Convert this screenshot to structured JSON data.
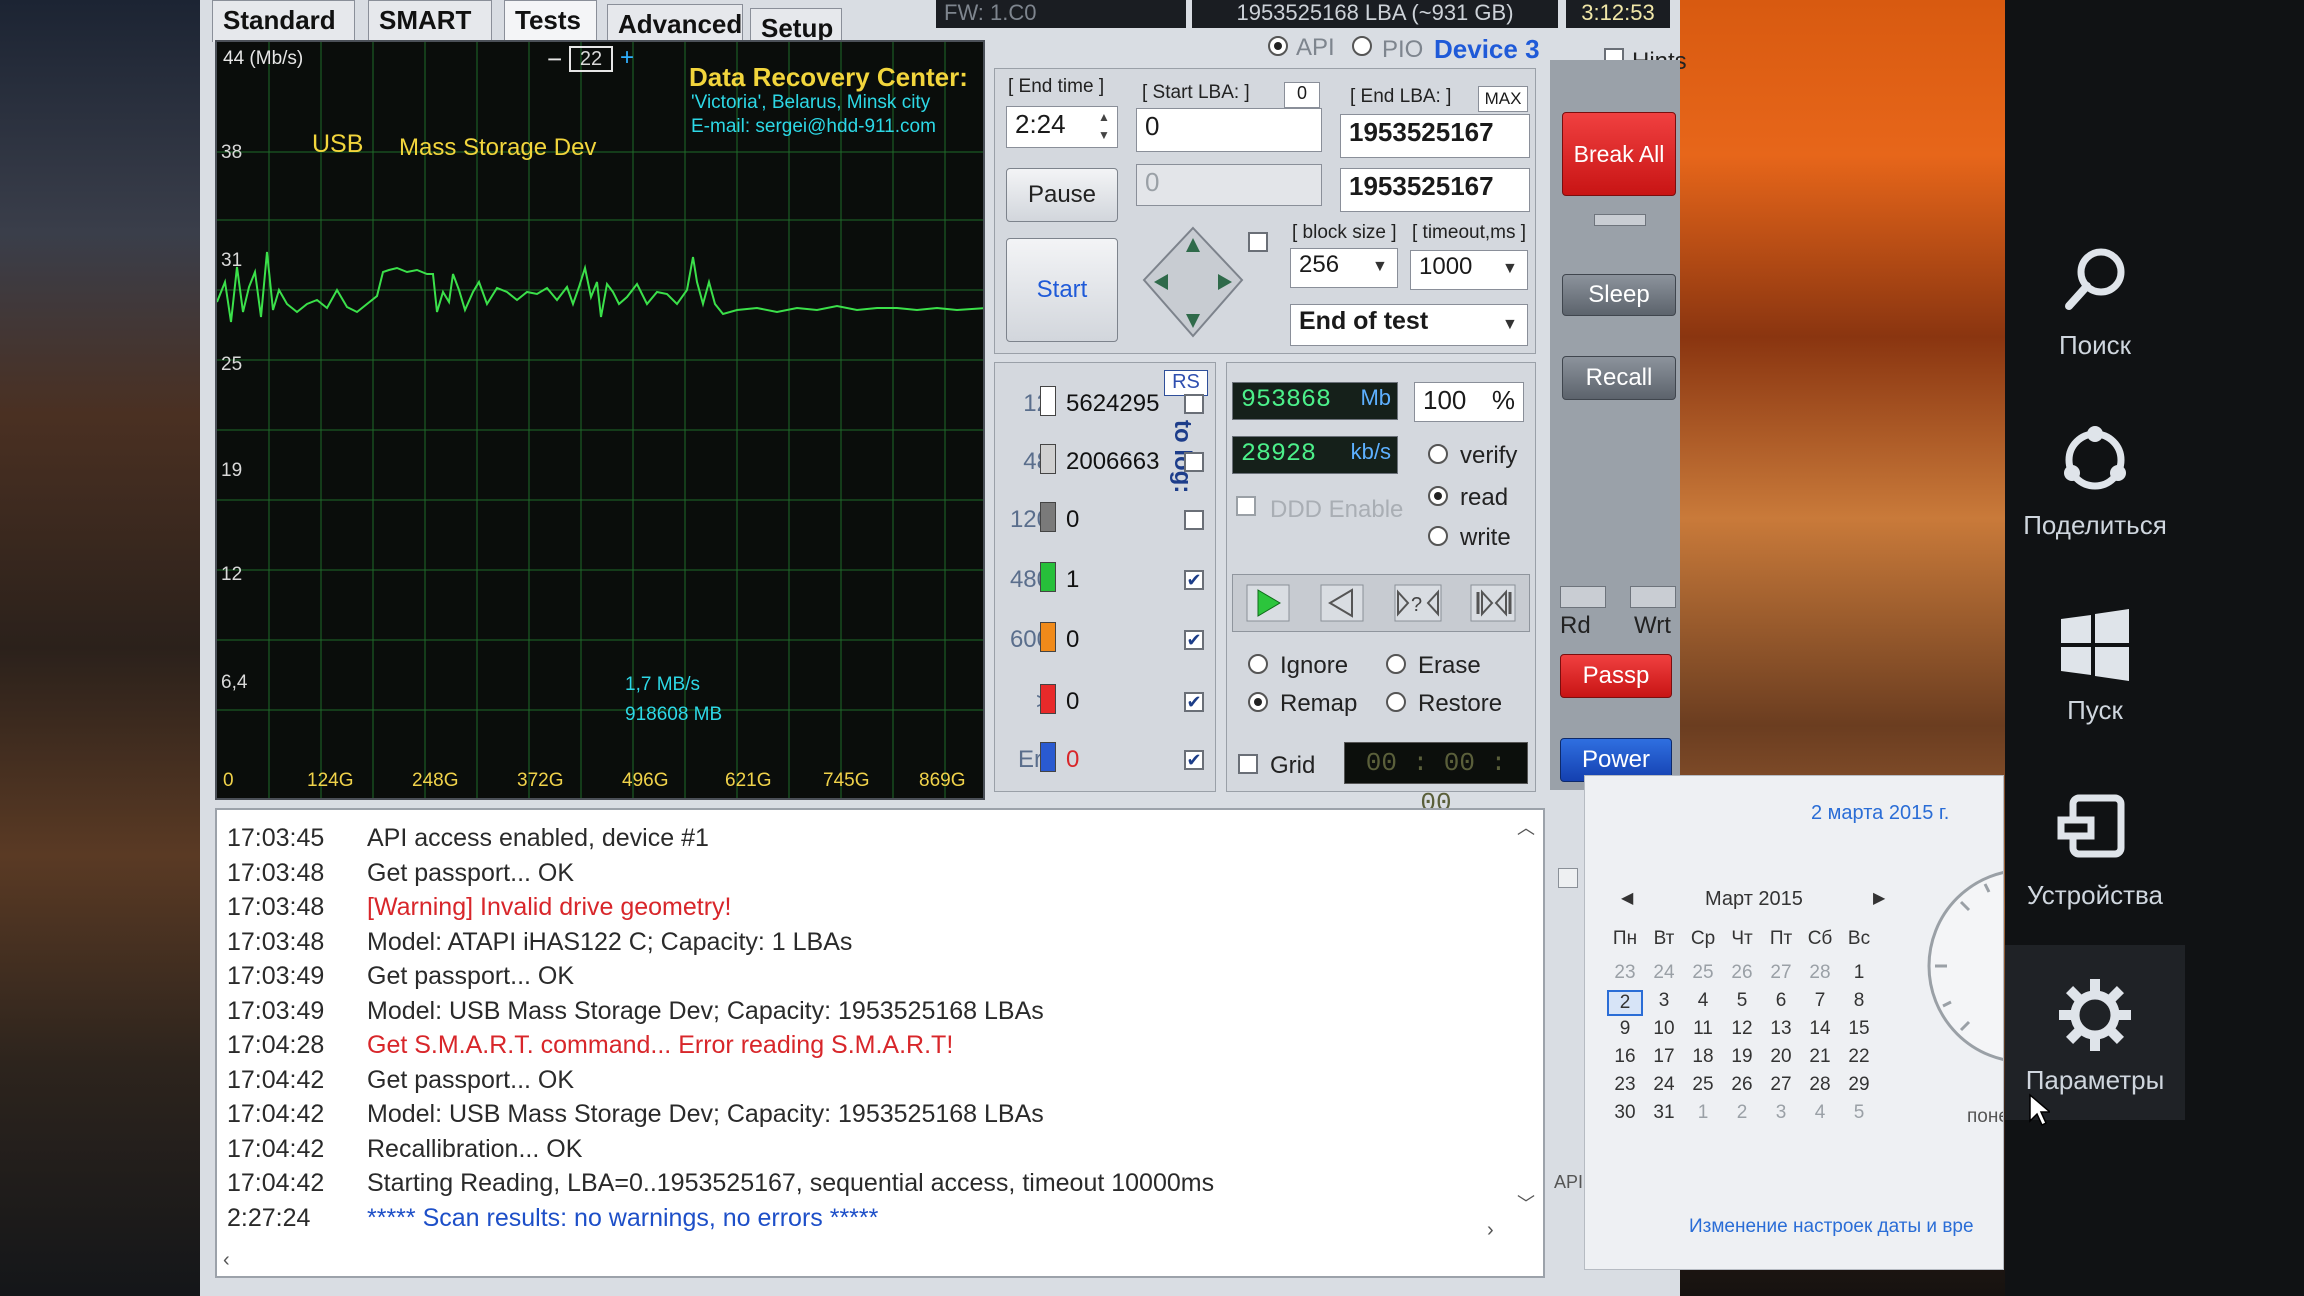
{
  "tabs": [
    "Standard",
    "SMART",
    "Tests",
    "Advanced",
    "Setup"
  ],
  "top_status": {
    "device_label": "FW: 1.C0",
    "lba_info": "1953525168 LBA (~931 GB)",
    "clock": "3:12:53"
  },
  "graph": {
    "speed_unit": "44 (Mb/s)",
    "zoom_minus": "−",
    "zoom_value": "22",
    "zoom_plus": "+",
    "device_name_1": "USB",
    "device_name_2": "Mass Storage Dev",
    "dr_title": "Data Recovery Center:",
    "dr_line2": "'Victoria', Belarus, Minsk city",
    "dr_line3": "E-mail: sergei@hdd-911.com",
    "y_ticks": [
      "38",
      "31",
      "25",
      "19",
      "12",
      "6,4"
    ],
    "x_ticks": [
      "0",
      "124G",
      "248G",
      "372G",
      "496G",
      "621G",
      "745G",
      "869G"
    ],
    "cursor_speed": "1,7 MB/s",
    "cursor_pos": "918608 MB"
  },
  "controls": {
    "api_label": "API",
    "pio_label": "PIO",
    "device_label": "Device 3",
    "hints_label": "Hints",
    "end_time_label": "[ End time ]",
    "end_time_value": "2:24",
    "start_lba_label": "[ Start LBA: ]",
    "start_lba_zero": "0",
    "start_lba_value": "0",
    "start_lba_cur": "0",
    "end_lba_label": "[ End LBA: ]",
    "max_label": "MAX",
    "end_lba_value": "1953525167",
    "end_lba_cur": "1953525167",
    "pause_label": "Pause",
    "start_label": "Start",
    "block_size_label": "[ block size ]",
    "block_size_value": "256",
    "timeout_label": "[ timeout,ms ]",
    "timeout_value": "1000",
    "end_action": "End of test",
    "break_all": "Break All",
    "sleep": "Sleep",
    "recall": "Recall",
    "rd": "Rd",
    "wrt": "Wrt",
    "passp": "Passp",
    "power": "Power"
  },
  "stats": {
    "rs_label": "RS",
    "to_log_label": "to log:",
    "rows": [
      {
        "ms": "12",
        "count": "5624295",
        "color": "#ffffff",
        "checked": ""
      },
      {
        "ms": "48",
        "count": "2006663",
        "color": "#d0d0d0",
        "checked": ""
      },
      {
        "ms": "120",
        "count": "0",
        "color": "#7a7a7a",
        "checked": ""
      },
      {
        "ms": "480",
        "count": "1",
        "color": "#27c03a",
        "checked": "✔"
      },
      {
        "ms": "600",
        "count": "0",
        "color": "#f08a1a",
        "checked": "✔"
      },
      {
        "ms": ">",
        "count": "0",
        "color": "#e82a2a",
        "checked": "✔"
      },
      {
        "ms": "Err",
        "count": "0",
        "color": "#2a5ad0",
        "checked": "✔"
      }
    ]
  },
  "progress": {
    "mb_value": "953868",
    "mb_unit": "Mb",
    "percent": "100",
    "percent_unit": "%",
    "speed_value": "28928",
    "speed_unit": "kb/s",
    "ddd_label": "DDD Enable",
    "mode_verify": "verify",
    "mode_read": "read",
    "mode_write": "write",
    "ignore": "Ignore",
    "erase": "Erase",
    "remap": "Remap",
    "restore": "Restore",
    "grid": "Grid",
    "timer": "00 : 00 : 00"
  },
  "log": [
    {
      "time": "17:03:45",
      "text": "API access enabled, device #1",
      "kind": "normal"
    },
    {
      "time": "17:03:48",
      "text": "Get passport... OK",
      "kind": "normal"
    },
    {
      "time": "17:03:48",
      "text": "[Warning] Invalid drive geometry!",
      "kind": "warn"
    },
    {
      "time": "17:03:48",
      "text": "Model: ATAPI   iHAS122    C; Capacity: 1 LBAs",
      "kind": "normal"
    },
    {
      "time": "17:03:49",
      "text": "Get passport... OK",
      "kind": "normal"
    },
    {
      "time": "17:03:49",
      "text": "Model: USB      Mass Storage Dev; Capacity: 1953525168 LBAs",
      "kind": "normal"
    },
    {
      "time": "17:04:28",
      "text": "Get S.M.A.R.T. command... Error reading S.M.A.R.T!",
      "kind": "warn"
    },
    {
      "time": "17:04:42",
      "text": "Get passport... OK",
      "kind": "normal"
    },
    {
      "time": "17:04:42",
      "text": "Model: USB      Mass Storage Dev; Capacity: 1953525168 LBAs",
      "kind": "normal"
    },
    {
      "time": "17:04:42",
      "text": "Recallibration... OK",
      "kind": "normal"
    },
    {
      "time": "17:04:42",
      "text": "Starting Reading, LBA=0..1953525167, sequential access, timeout 10000ms",
      "kind": "normal"
    },
    {
      "time": "2:27:24",
      "text": "***** Scan results: no warnings, no errors *****",
      "kind": "info"
    }
  ],
  "calendar": {
    "date_header": "2 марта 2015 г.",
    "month": "Март 2015",
    "weekdays": [
      "Пн",
      "Вт",
      "Ср",
      "Чт",
      "Пт",
      "Сб",
      "Вс"
    ],
    "weeks": [
      [
        "23",
        "24",
        "25",
        "26",
        "27",
        "28",
        "1"
      ],
      [
        "2",
        "3",
        "4",
        "5",
        "6",
        "7",
        "8"
      ],
      [
        "9",
        "10",
        "11",
        "12",
        "13",
        "14",
        "15"
      ],
      [
        "16",
        "17",
        "18",
        "19",
        "20",
        "21",
        "22"
      ],
      [
        "23",
        "24",
        "25",
        "26",
        "27",
        "28",
        "29"
      ],
      [
        "30",
        "31",
        "1",
        "2",
        "3",
        "4",
        "5"
      ]
    ],
    "selected_day": "2",
    "footer_link": "Изменение настроек даты и вре",
    "side_text": "поне"
  },
  "charms": {
    "search": "Поиск",
    "share": "Поделиться",
    "start": "Пуск",
    "devices": "Устройства",
    "settings": "Параметры"
  },
  "misc": {
    "api_small": "API"
  }
}
